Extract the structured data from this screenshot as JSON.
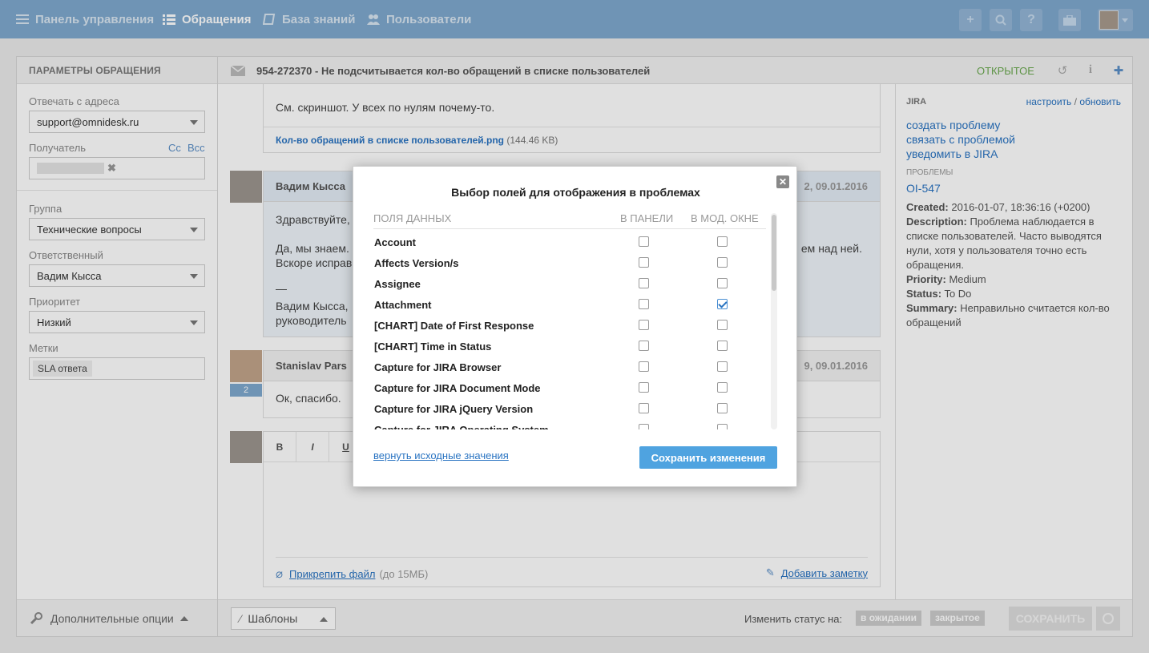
{
  "nav": {
    "items": [
      {
        "label": "Панель управления",
        "icon": "dashboard-icon"
      },
      {
        "label": "Обращения",
        "icon": "list-icon"
      },
      {
        "label": "База знаний",
        "icon": "book-icon"
      },
      {
        "label": "Пользователи",
        "icon": "users-icon"
      }
    ],
    "buttons": [
      "plus-icon",
      "search-icon",
      "help-icon",
      "briefcase-icon"
    ]
  },
  "left_panel": {
    "title": "ПАРАМЕТРЫ ОБРАЩЕНИЯ",
    "reply_from_label": "Отвечать с адреса",
    "reply_from_value": "support@omnidesk.ru",
    "recipient_label": "Получатель",
    "cc_label": "Cc",
    "bcc_label": "Bcc",
    "group_label": "Группа",
    "group_value": "Технические вопросы",
    "assignee_label": "Ответственный",
    "assignee_value": "Вадим Кысса",
    "priority_label": "Приоритет",
    "priority_value": "Низкий",
    "tags_label": "Метки",
    "tag_value": "SLA ответа",
    "footer_label": "Дополнительные опции"
  },
  "ticket": {
    "title": "954-272370 - Не подсчитывается кол-во обращений в списке пользователей",
    "status": "ОТКРЫТОЕ",
    "message1_text": "См. скриншот. У всех по нулям почему-то.",
    "attachment_name": "Кол-во обращений в списке пользователей.png",
    "attachment_size": "(144.46 KB)",
    "msg2_author": "Вадим Кысса",
    "msg2_date": "2, 09.01.2016",
    "msg2_line1": "Здравствуйте,",
    "msg2_line2": "Да, мы знаем.",
    "msg2_line2_end": "ем над ней.",
    "msg2_line3": "Вскоре исправ",
    "msg2_sig_dash": "—",
    "msg2_sig_name": "Вадим Кысса,",
    "msg2_sig_role": "руководитель",
    "msg3_author": "Stanislav Pars",
    "msg3_date": "9, 09.01.2016",
    "msg3_badge": "2",
    "msg3_text": "Ок, спасибо.",
    "editor_bold": "B",
    "editor_italic": "I",
    "editor_underline": "U",
    "attach_file_label": "Прикрепить файл",
    "attach_limit": "(до 15МБ)",
    "add_note_label": "Добавить заметку",
    "templates_label": "Шаблоны",
    "change_status_label": "Изменить статус на:",
    "status_pending": "в ожидании",
    "status_closed": "закрытое",
    "save_label": "СОХРАНИТЬ"
  },
  "jira": {
    "title": "JIRA",
    "configure": "настроить",
    "separator": "/",
    "refresh": "обновить",
    "create_issue": "создать проблему",
    "link_issue": "связать с проблемой",
    "notify": "уведомить в JIRA",
    "issues_label": "ПРОБЛЕМЫ",
    "issue_key": "OI-547",
    "created_label": "Created:",
    "created_value": "2016-01-07, 18:36:16 (+0200)",
    "description_label": "Description:",
    "description_value": "Проблема наблюдается в списке пользователей. Часто выводятся нули, хотя у пользователя точно есть обращения.",
    "priority_label": "Priority:",
    "priority_value": "Medium",
    "status_label": "Status:",
    "status_value": "To Do",
    "summary_label": "Summary:",
    "summary_value": "Неправильно считается кол-во обращений"
  },
  "modal": {
    "title": "Выбор полей для отображения в проблемах",
    "col_fields": "ПОЛЯ ДАННЫХ",
    "col_panel": "В ПАНЕЛИ",
    "col_modal": "В МОД. ОКНЕ",
    "rows": [
      {
        "name": "Account",
        "panel": false,
        "modal": false
      },
      {
        "name": "Affects Version/s",
        "panel": false,
        "modal": false
      },
      {
        "name": "Assignee",
        "panel": false,
        "modal": false
      },
      {
        "name": "Attachment",
        "panel": false,
        "modal": true
      },
      {
        "name": "[CHART] Date of First Response",
        "panel": false,
        "modal": false
      },
      {
        "name": "[CHART] Time in Status",
        "panel": false,
        "modal": false
      },
      {
        "name": "Capture for JIRA Browser",
        "panel": false,
        "modal": false
      },
      {
        "name": "Capture for JIRA Document Mode",
        "panel": false,
        "modal": false
      },
      {
        "name": "Capture for JIRA jQuery Version",
        "panel": false,
        "modal": false
      },
      {
        "name": "Capture for JIRA Operating System",
        "panel": false,
        "modal": false
      }
    ],
    "reset_label": "вернуть исходные значения",
    "save_label": "Сохранить изменения",
    "close_label": "✕"
  }
}
